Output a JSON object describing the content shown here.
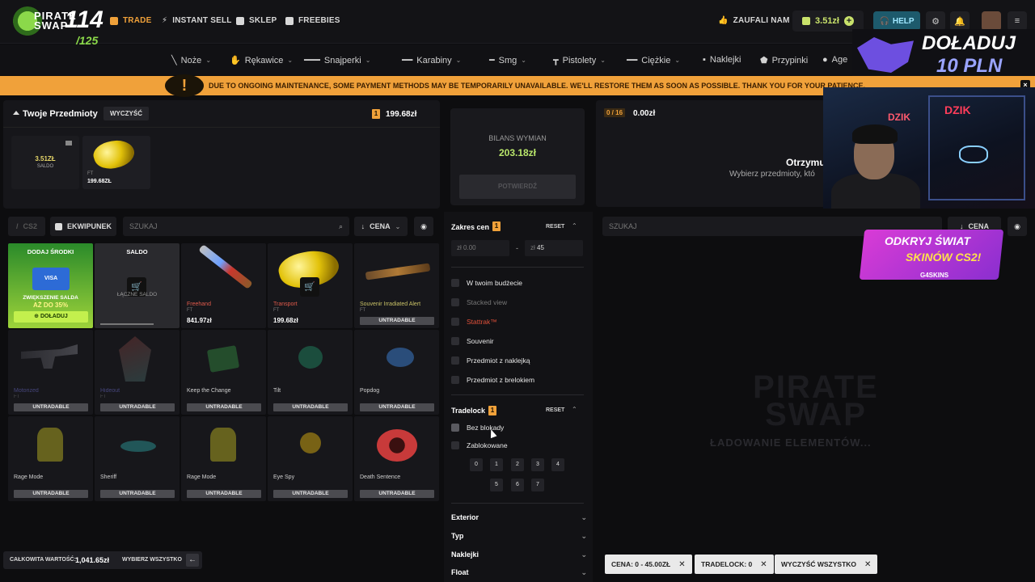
{
  "nav": {
    "logo_top": "PIRATE",
    "logo_bottom": "SWAP",
    "logo_number": "114",
    "logo_sub": "/125",
    "links": [
      {
        "label": "TRADE",
        "icon": "trade-icon"
      },
      {
        "label": "INSTANT SELL",
        "icon": "bolt-icon"
      },
      {
        "label": "SKLEP",
        "icon": "store-icon"
      },
      {
        "label": "FREEBIES",
        "icon": "gift-icon"
      }
    ],
    "trusted": "ZAUFALI NAM",
    "balance": "3.51zł",
    "help": "HELP"
  },
  "categories": [
    "Noże",
    "Rękawice",
    "Snajperki",
    "Karabiny",
    "Smg",
    "Pistolety",
    "Ciężkie",
    "Naklejki",
    "Przypinki",
    "Age"
  ],
  "promo_top": {
    "line1": "DOŁADUJ",
    "line2": "10 PLN"
  },
  "banner": {
    "message": "DUE TO ONGOING MAINTENANCE, SOME PAYMENT METHODS MAY BE TEMPORARILY UNAVAILABLE. WE'LL RESTORE THEM AS SOON AS POSSIBLE. THANK YOU FOR YOUR PATIENCE.",
    "close": "×"
  },
  "your_items": {
    "title": "Twoje Przedmioty",
    "clear": "WYCZYŚĆ",
    "count": "1",
    "total": "199.68zł",
    "saldo_value": "3.51ZŁ",
    "saldo_label": "SALDO",
    "selected_exterior": "FT",
    "selected_price": "199.68ZŁ"
  },
  "toolbar": {
    "game": "CS2",
    "inventory": "EKWIPUNEK",
    "search_placeholder": "SZUKAJ",
    "sort": "CENA"
  },
  "grid": {
    "deposit_title": "DODAJ ŚRODKI",
    "deposit_card": "VISA",
    "deposit_promo1": "ZWIĘKSZENIE SALDA",
    "deposit_promo2": "AŻ DO 35%",
    "deposit_button": "DOŁADUJ",
    "saldo_title": "SALDO",
    "saldo_sub": "ŁĄCZNE SALDO",
    "untradable": "UNTRADABLE",
    "items": [
      {
        "name": "Freehand",
        "exterior": "FT",
        "price": "841.97zł",
        "name_color": "#e05a4b"
      },
      {
        "name": "Transport",
        "exterior": "FT",
        "price": "199.68zł",
        "name_color": "#e05a4b"
      },
      {
        "name": "Souvenir Irradiated Alert",
        "exterior": "FT",
        "price": "",
        "name_color": "#c9c267"
      },
      {
        "name": "Motorized",
        "exterior": "FT",
        "price": "",
        "name_color": "#6a6ac8"
      },
      {
        "name": "Hideout",
        "exterior": "FT",
        "price": "",
        "name_color": "#6a6ac8"
      },
      {
        "name": "Keep the Change",
        "exterior": "",
        "price": "",
        "name_color": "#cfcfcf"
      },
      {
        "name": "Tilt",
        "exterior": "",
        "price": "",
        "name_color": "#cfcfcf"
      },
      {
        "name": "Popdog",
        "exterior": "",
        "price": "",
        "name_color": "#cfcfcf"
      },
      {
        "name": "Rage Mode",
        "exterior": "",
        "price": "",
        "name_color": "#cfcfcf"
      },
      {
        "name": "Sheriff",
        "exterior": "",
        "price": "",
        "name_color": "#cfcfcf"
      },
      {
        "name": "Rage Mode",
        "exterior": "",
        "price": "",
        "name_color": "#cfcfcf"
      },
      {
        "name": "Eye Spy",
        "exterior": "",
        "price": "",
        "name_color": "#cfcfcf"
      },
      {
        "name": "Death Sentence",
        "exterior": "",
        "price": "",
        "name_color": "#cfcfcf"
      }
    ]
  },
  "balance": {
    "label": "BILANS WYMIAN",
    "value": "203.18zł",
    "confirm": "POTWIERDŹ"
  },
  "filters": {
    "price_title": "Zakres cen",
    "price_count": "1",
    "reset": "RESET",
    "currency": "zł",
    "min_placeholder": "0.00",
    "max_value": "45",
    "dash": "-",
    "options": [
      "W twoim budżecie",
      "Stacked view",
      "Stattrak™",
      "Souvenir",
      "Przedmiot z naklejką",
      "Przedmiot z brelokiem"
    ],
    "tradelock_title": "Tradelock",
    "tradelock_count": "1",
    "tradelock_options": [
      "Bez blokady",
      "Zablokowane"
    ],
    "days": [
      "0",
      "1",
      "2",
      "3",
      "4",
      "5",
      "6",
      "7"
    ],
    "sections": [
      "Exterior",
      "Typ",
      "Naklejki",
      "Float"
    ]
  },
  "right": {
    "slots": "0 / 16",
    "value": "0.00zł",
    "receive": "Otrzymu",
    "hint": "Wybierz przedmioty, któ",
    "search_placeholder": "SZUKAJ",
    "sort": "CENA",
    "loading_logo1": "PIRATE",
    "loading_logo2": "SWAP",
    "loading": "ŁADOWANIE ELEMENTÓW...",
    "chips": [
      "CENA: 0 - 45.00ZŁ",
      "TRADELOCK: 0",
      "WYCZYŚĆ WSZYSTKO"
    ]
  },
  "promo2": {
    "line1": "ODKRYJ ŚWIAT",
    "line2": "SKINÓW CS2!",
    "brand": "G4SKINS"
  },
  "webcam": {
    "sign1": "DZIK",
    "sign2": "DZIK"
  },
  "footer": {
    "total_label": "CAŁKOWITA WARTOŚĆ:",
    "total_value": "1,041.65zł",
    "select_all": "WYBIERZ WSZYSTKO"
  },
  "colors": {
    "accent": "#f0a13a",
    "green": "#b9e66b",
    "help": "#1d5a6c",
    "bg": "#0d0d0f"
  }
}
